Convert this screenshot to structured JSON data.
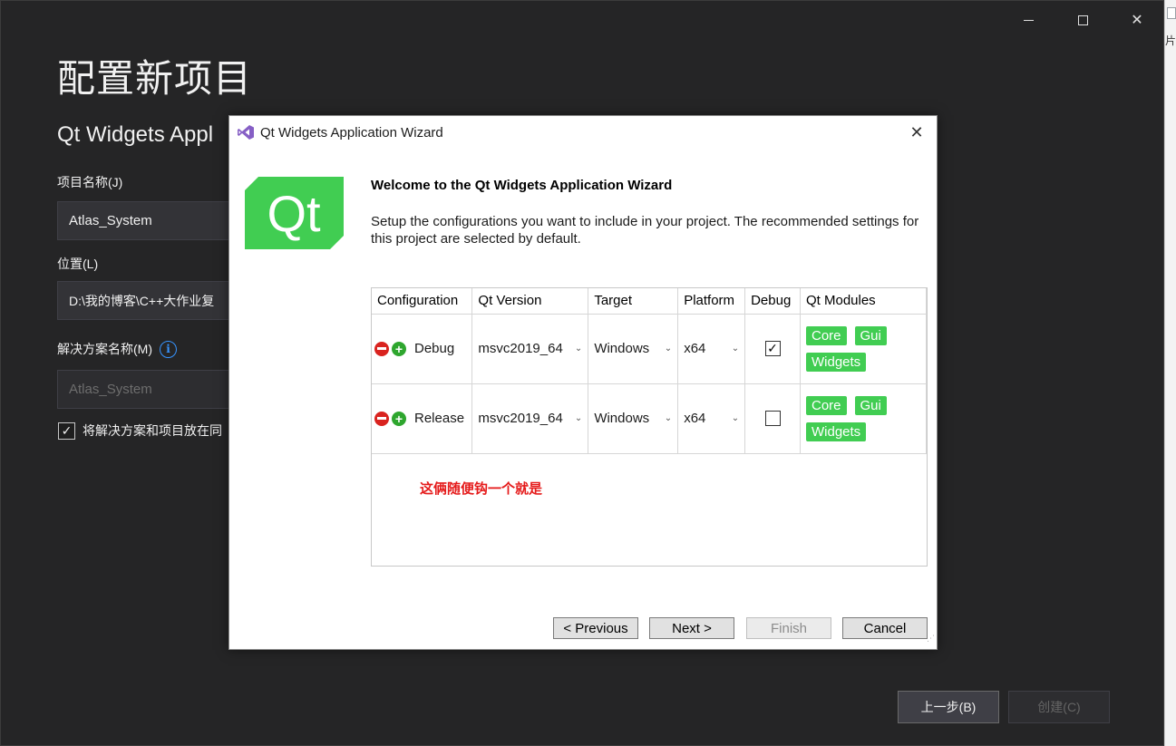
{
  "vs": {
    "page_title": "配置新项目",
    "subtitle": "Qt Widgets Appl",
    "name_label": "项目名称(J)",
    "name_value": "Atlas_System",
    "location_label": "位置(L)",
    "location_value": "D:\\我的博客\\C++大作业复",
    "solution_label": "解决方案名称(M)",
    "solution_value": "Atlas_System",
    "same_dir_label": "将解决方案和项目放在同",
    "same_dir_checked": true,
    "back_button": "上一步(B)",
    "create_button": "创建(C)"
  },
  "side": {
    "text": "片"
  },
  "dialog": {
    "title": "Qt Widgets Application Wizard",
    "logo_text": "Qt",
    "welcome": "Welcome to the Qt Widgets Application Wizard",
    "setup_text": "Setup the configurations you want to include in your project. The recommended settings for this project are selected by default.",
    "columns": [
      "Configuration",
      "Qt Version",
      "Target",
      "Platform",
      "Debug",
      "Qt Modules"
    ],
    "rows": [
      {
        "configuration": "Debug",
        "qt_version": "msvc2019_64",
        "target": "Windows",
        "platform": "x64",
        "debug": true,
        "modules": [
          "Core",
          "Gui",
          "Widgets"
        ]
      },
      {
        "configuration": "Release",
        "qt_version": "msvc2019_64",
        "target": "Windows",
        "platform": "x64",
        "debug": false,
        "modules": [
          "Core",
          "Gui",
          "Widgets"
        ]
      }
    ],
    "annotation": "这俩随便钩一个就是",
    "buttons": {
      "previous": "< Previous",
      "next": "Next >",
      "finish": "Finish",
      "cancel": "Cancel"
    }
  },
  "colors": {
    "qt_green": "#41cd52",
    "annotation_red": "#e51b1b",
    "vs_background": "#252526",
    "info_blue": "#3794ff"
  },
  "icons": [
    "minimize-icon",
    "maximize-icon",
    "close-icon",
    "info-icon",
    "checkmark-icon",
    "visual-studio-logo-icon",
    "qt-logo",
    "remove-config-icon",
    "add-config-icon",
    "chevron-down-icon"
  ]
}
